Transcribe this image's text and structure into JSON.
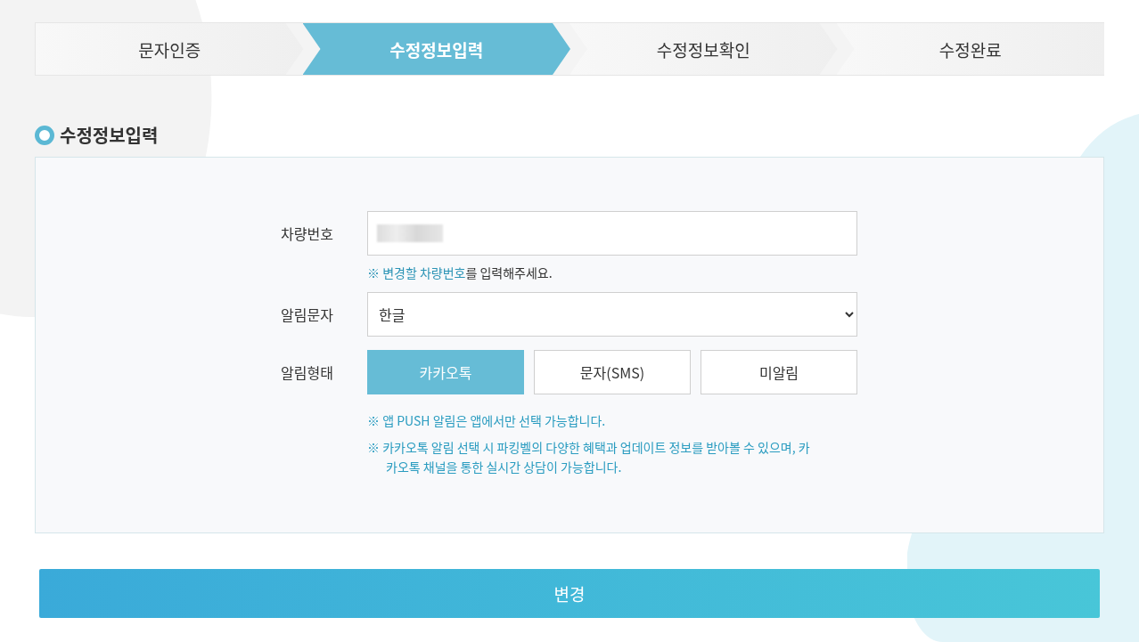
{
  "steps": [
    {
      "label": "문자인증",
      "selected": false
    },
    {
      "label": "수정정보입력",
      "selected": true
    },
    {
      "label": "수정정보확인",
      "selected": false
    },
    {
      "label": "수정완료",
      "selected": false
    }
  ],
  "section_title": "수정정보입력",
  "form": {
    "vehicle": {
      "label": "차량번호",
      "value_redacted": true,
      "hint": {
        "mark": "※ ",
        "highlight": "변경할 차량번호",
        "rest": "를 입력해주세요."
      }
    },
    "message_language": {
      "label": "알림문자",
      "value": "한글"
    },
    "notify_type": {
      "label": "알림형태",
      "options": [
        {
          "label": "카카오톡",
          "selected": true
        },
        {
          "label": "문자(SMS)",
          "selected": false
        },
        {
          "label": "미알림",
          "selected": false
        }
      ],
      "notes": [
        "※ 앱 PUSH 알림은 앱에서만 선택 가능합니다.",
        "※ 카카오톡 알림 선택 시 파킹벨의 다양한 혜택과 업데이트 정보를 받아볼 수 있으며, 카카오톡 채널을 통한 실시간 상담이 가능합니다."
      ]
    }
  },
  "submit": "변경"
}
